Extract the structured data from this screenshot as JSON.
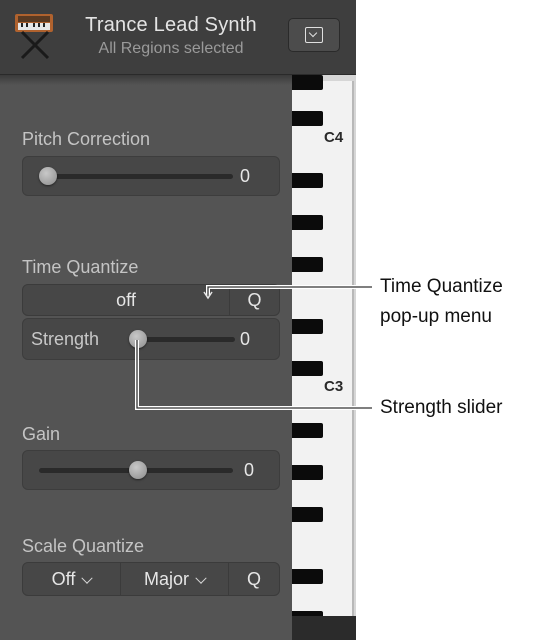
{
  "header": {
    "title": "Trance Lead Synth",
    "subtitle": "All Regions selected",
    "icon": "synthesizer-keyboard-icon"
  },
  "pitch_correction": {
    "label": "Pitch Correction",
    "value": "0",
    "slider_fraction": 0
  },
  "time_quantize": {
    "label": "Time Quantize",
    "popup_value": "off",
    "q_button": "Q",
    "strength_label": "Strength",
    "strength_value": "0",
    "strength_fraction": 0
  },
  "gain": {
    "label": "Gain",
    "value": "0",
    "slider_fraction": 0.5
  },
  "scale_quantize": {
    "label": "Scale Quantize",
    "mode": "Off",
    "scale": "Major",
    "q_button": "Q"
  },
  "keyboard": {
    "labels": [
      "C4",
      "C3"
    ]
  },
  "callouts": {
    "time_quantize_line1": "Time Quantize",
    "time_quantize_line2": "pop-up menu",
    "strength": "Strength slider"
  }
}
